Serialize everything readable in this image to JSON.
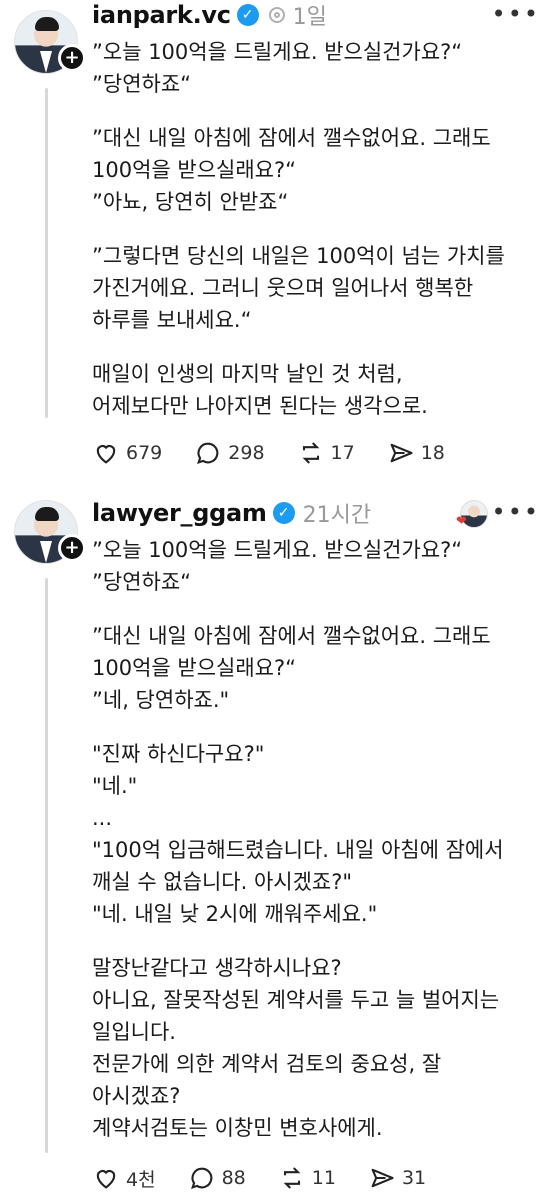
{
  "post1": {
    "username": "ianpark.vc",
    "timestamp": "1일",
    "paragraphs": [
      "”오늘 100억을 드릴게요. 받으실건가요?“\n”당연하죠“",
      "”대신 내일 아침에 잠에서 깰수없어요. 그래도\n100억을 받으실래요?“\n”아뇨, 당연히 안받죠“",
      "”그렇다면 당신의 내일은 100억이 넘는 가치를\n가진거에요. 그러니 웃으며 일어나서 행복한\n하루를 보내세요.“",
      "매일이 인생의 마지막 날인 것 처럼,\n어제보다만 나아지면 된다는 생각으로."
    ],
    "likes": "679",
    "comments": "298",
    "reposts": "17",
    "shares": "18"
  },
  "post2": {
    "username": "lawyer_ggam",
    "timestamp": "21시간",
    "paragraphs": [
      "”오늘 100억을 드릴게요. 받으실건가요?“\n”당연하죠“",
      "”대신 내일 아침에 잠에서 깰수없어요. 그래도\n100억을 받으실래요?“\n”네, 당연하죠.\"",
      "\"진짜 하신다구요?\"\n\"네.\"\n...\n\"100억 입금해드렸습니다. 내일 아침에 잠에서\n깨실 수 없습니다. 아시겠죠?\"\n\"네. 내일 낮 2시에 깨워주세요.\"",
      "말장난같다고 생각하시나요?\n아니요, 잘못작성된 계약서를 두고 늘 벌어지는\n일입니다.\n전문가에 의한 계약서 검토의 중요성, 잘\n아시겠죠?\n계약서검토는 이창민 변호사에게."
    ],
    "likes": "4천",
    "comments": "88",
    "reposts": "11",
    "shares": "31"
  },
  "icons": {
    "verified": "verified-badge-icon",
    "like": "heart-icon",
    "comment": "comment-icon",
    "repost": "repost-icon",
    "share": "share-icon",
    "more": "more-icon",
    "follow": "plus-icon"
  },
  "colors": {
    "verified": "#1d9bf0",
    "muted": "#999999"
  }
}
